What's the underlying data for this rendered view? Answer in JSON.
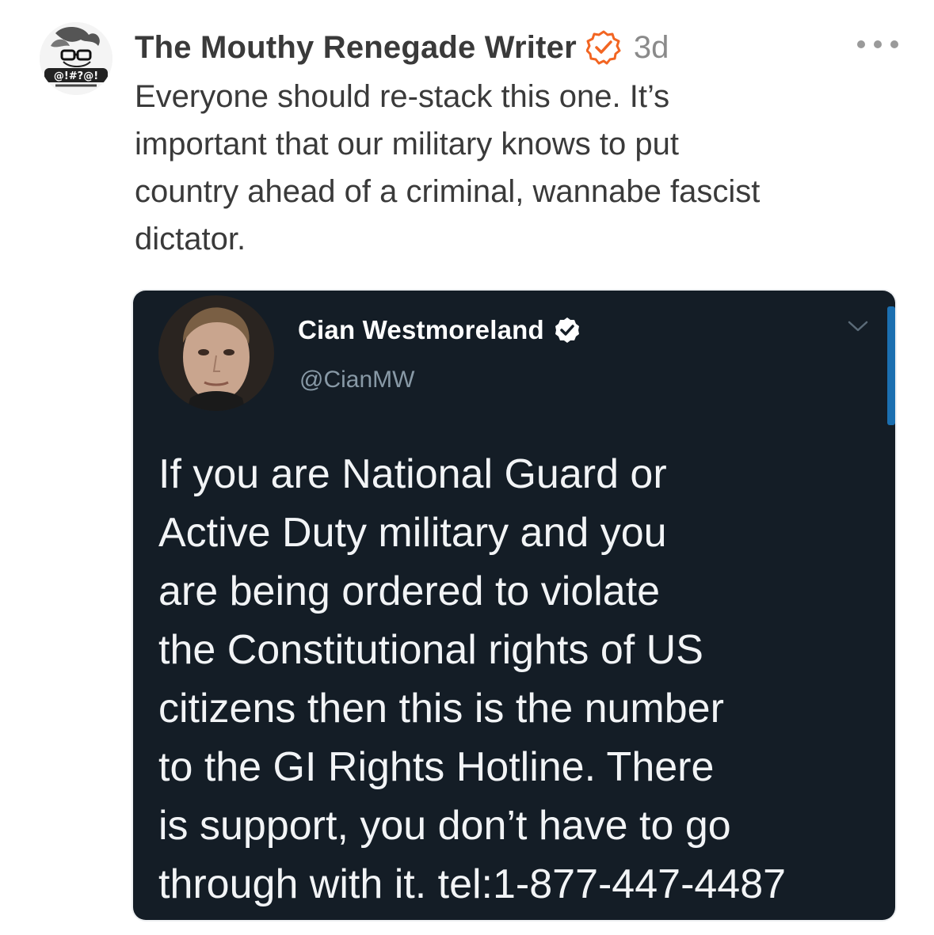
{
  "post": {
    "author": "The Mouthy Renegade Writer",
    "time": "3d",
    "text": "Everyone should re-stack this one. It’s\nimportant that our military knows to put\ncountry ahead of a criminal, wannabe fascist\ndictator.",
    "avatar_text": "@!#?@!",
    "accent_color": "#f26522"
  },
  "embed": {
    "name": "Cian Westmoreland",
    "handle": "@CianMW",
    "body": "If you are National Guard or\nActive Duty military and you\nare being ordered to violate\nthe Constitutional rights of US\ncitizens then this is the number\nto the GI Rights Hotline. There\nis support, you don’t have to go\nthrough with it. tel:1-877-447-4487",
    "background_color": "#141d26"
  },
  "icons": {
    "verified": "verified-check-icon",
    "more": "more-options-icon",
    "chevron": "chevron-down-icon"
  }
}
